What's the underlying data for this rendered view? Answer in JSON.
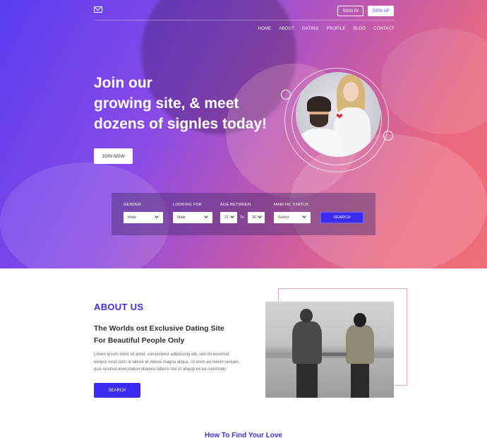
{
  "header": {
    "sign_in": "SIGN IN",
    "sign_up": "SIGN UP",
    "nav": [
      "HOME",
      "ABOUT",
      "DATING",
      "PROFILE",
      "BLOG",
      "CONTACT"
    ]
  },
  "hero": {
    "title_lines": [
      "Join our",
      "growing site, & meet",
      "dozens of signles today!"
    ],
    "join_button": "JOIN NOW"
  },
  "search": {
    "gender_label": "GENDER",
    "gender_value": "Male",
    "looking_label": "LOOKING FOR",
    "looking_value": "Male",
    "age_label": "AGE BETWEEN",
    "age_from": "21",
    "age_to_word": "To",
    "age_to": "30",
    "marital_label": "MARITAL STATUS",
    "marital_value": "Select",
    "search_button": "SEARCH"
  },
  "about": {
    "title": "ABOUT US",
    "subtitle_line1": "The Worlds ost Exclusive Dating Site",
    "subtitle_line2": "For Beautiful People Only",
    "body_line1": "Lorem ipsum dolor sit amet, consectetur adipisicing elit, sed do eiusmod",
    "body_line2": "tempor incid dunt ut labore et dolore magna aliqua. Ut enim ad minim veniam,",
    "body_line3": "quis nostrud exercitation ullamco laboris nisi ut aliquip ex ea commodo",
    "button": "SEARCH"
  },
  "how": {
    "title": "How To Find Your Love"
  },
  "colors": {
    "accent": "#3b2bef",
    "heading": "#3f2ee2",
    "gradient_start": "#5a3df0",
    "gradient_end": "#ef6e78"
  }
}
